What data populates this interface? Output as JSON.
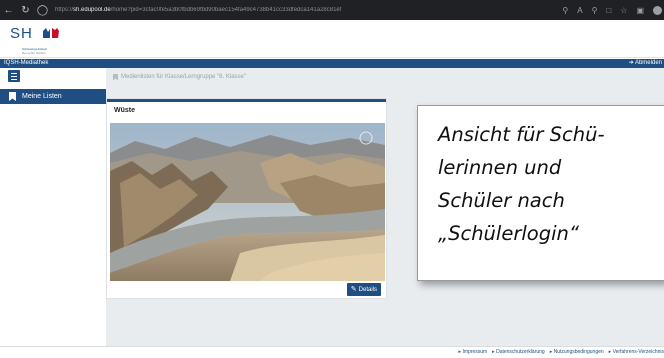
{
  "browser": {
    "back_icon": "arrow-left-icon",
    "reload_icon": "reload-icon",
    "lock_icon": "lock-icon",
    "url_scheme": "https://",
    "url_host": "sh.edupool.de",
    "url_path": "/home?pid=3cfac0fe5a3b0fbdb69fbd90baec154fa49c4738b41cc33dfedca141a28c81ef",
    "icons": [
      "key-icon",
      "read-aloud-icon",
      "zoom-icon",
      "extensions-icon",
      "favorites-icon",
      "collections-icon",
      "profile-icon"
    ]
  },
  "header": {
    "logo_text": "SH",
    "logo_line1": "Schleswig-Holstein",
    "logo_line2": "Der echte Norden"
  },
  "topnav": {
    "app_title": "IQSH-Mediathek",
    "logout_label": "Abmelden",
    "logout_icon": "sign-out-icon"
  },
  "sidebar": {
    "items": [
      {
        "label": "Meine Listen",
        "icon": "bookmark-icon"
      }
    ]
  },
  "breadcrumb": {
    "text": "Medienlisten für Klasse/Lerngruppe \"6. Klasse\""
  },
  "card": {
    "title": "Wüste",
    "details_label": "Details",
    "details_icon": "edit-icon"
  },
  "note": {
    "lines": [
      "Ansicht für Schü-",
      "lerinnen und",
      "Schüler nach",
      "„Schülerlogin“"
    ]
  },
  "footer": {
    "links": [
      "Impressum",
      "Datenschutzerklärung",
      "Nutzungsbedingungen",
      "Verfahrens-Verzeichnis"
    ]
  },
  "colors": {
    "accent": "#1f4f82",
    "browser_bar": "#202124",
    "content_bg": "#e9ecef"
  }
}
